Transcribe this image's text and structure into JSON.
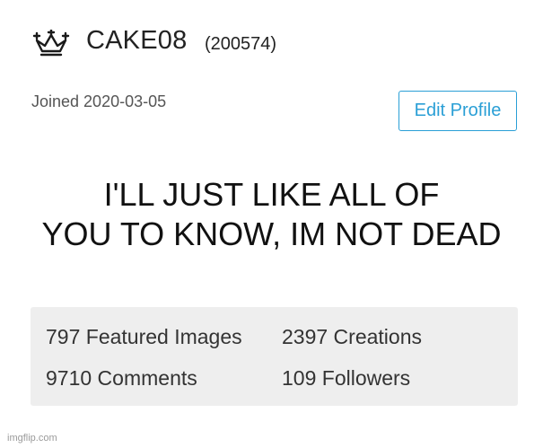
{
  "profile": {
    "username": "CAKE08",
    "user_id": "(200574)",
    "joined": "Joined 2020-03-05",
    "edit_button": "Edit Profile"
  },
  "caption": {
    "line1": "I'LL JUST LIKE ALL OF",
    "line2": "YOU TO KNOW, IM NOT DEAD"
  },
  "stats": {
    "featured_images": "797 Featured Images",
    "creations": "2397 Creations",
    "comments": "9710 Comments",
    "followers": "109 Followers"
  },
  "watermark": "imgflip.com",
  "icons": {
    "rank": "crown-icon"
  },
  "colors": {
    "accent": "#2a9fd6",
    "stats_bg": "#eeeeee"
  }
}
